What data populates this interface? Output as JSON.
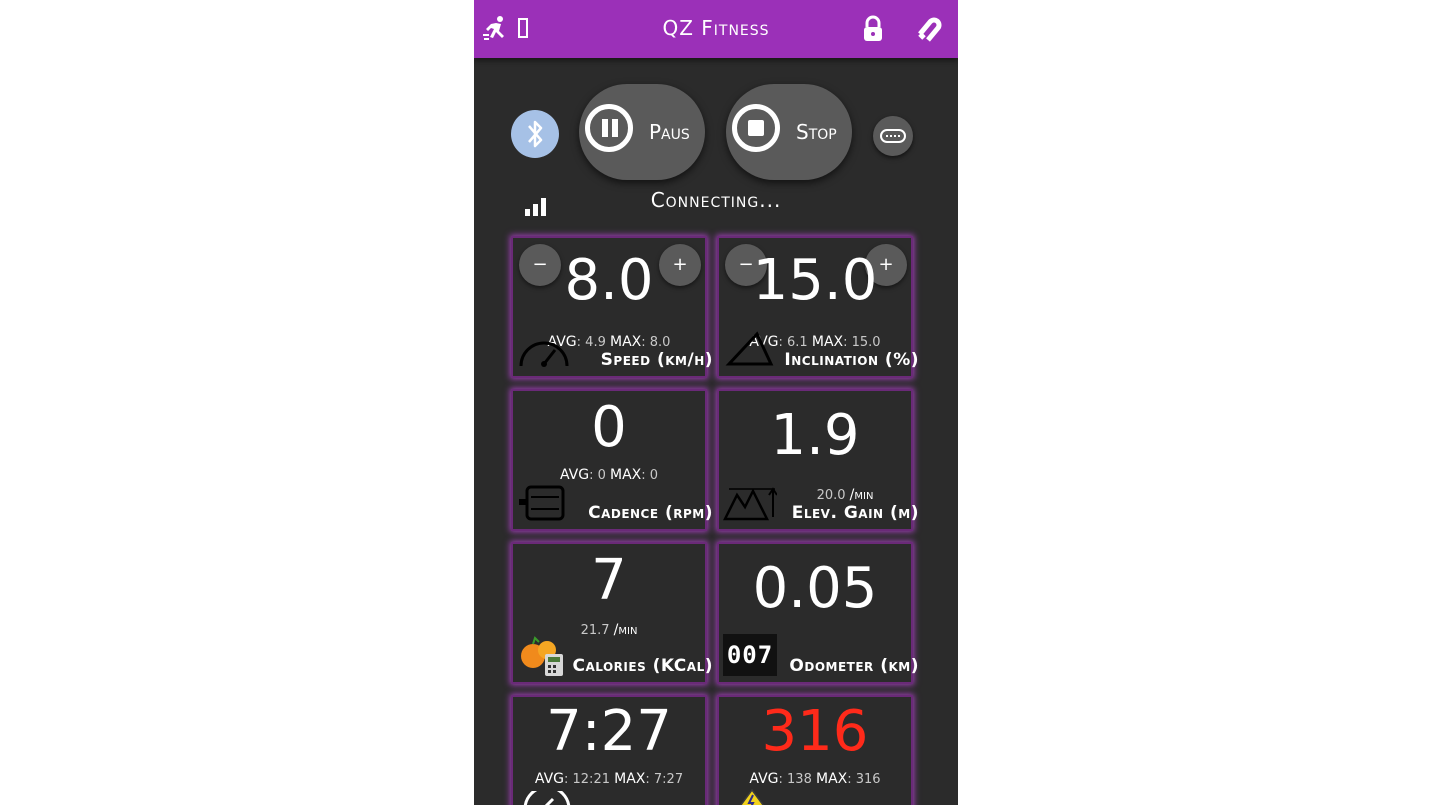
{
  "header": {
    "title": "QZ Fitness",
    "color": "#9b30b8"
  },
  "controls": {
    "pause_label": "Paus",
    "stop_label": "Stop"
  },
  "status": "Connecting...",
  "tiles": [
    {
      "id": "speed",
      "value": "8.0",
      "avg_label": "AVG",
      "avg": "4.9",
      "max_label": "MAX",
      "max": "8.0",
      "label": "Speed (km/h)",
      "icon": "speedometer-icon",
      "adjustable": true
    },
    {
      "id": "inclination",
      "value": "15.0",
      "avg_label": "AVG",
      "avg": "6.1",
      "max_label": "MAX",
      "max": "15.0",
      "label": "Inclination (%)",
      "icon": "incline-icon",
      "adjustable": true
    },
    {
      "id": "cadence",
      "value": "0",
      "avg_label": "AVG",
      "avg": "0",
      "max_label": "MAX",
      "max": "0",
      "label": "Cadence (rpm)",
      "icon": "pedal-icon"
    },
    {
      "id": "elevation",
      "value": "1.9",
      "rate": "20.0",
      "rate_unit": "/min",
      "label": "Elev. Gain (m)",
      "icon": "mountain-icon"
    },
    {
      "id": "calories",
      "value": "7",
      "rate": "21.7",
      "rate_unit": "/min",
      "label": "Calories (KCal)",
      "icon": "calories-icon"
    },
    {
      "id": "odometer",
      "value": "0.05",
      "label": "Odometer (km)",
      "icon": "odometer-icon",
      "odometer_digits": "007"
    },
    {
      "id": "pace",
      "value": "7:27",
      "avg_label": "AVG",
      "avg": "12:21",
      "max_label": "MAX",
      "max": "7:27",
      "icon": "pace-icon"
    },
    {
      "id": "watt",
      "value": "316",
      "value_color": "#ff2a1a",
      "avg_label": "AVG",
      "avg": "138",
      "max_label": "MAX",
      "max": "316",
      "icon": "power-icon"
    }
  ],
  "buttons": {
    "minus": "−",
    "plus": "+"
  }
}
